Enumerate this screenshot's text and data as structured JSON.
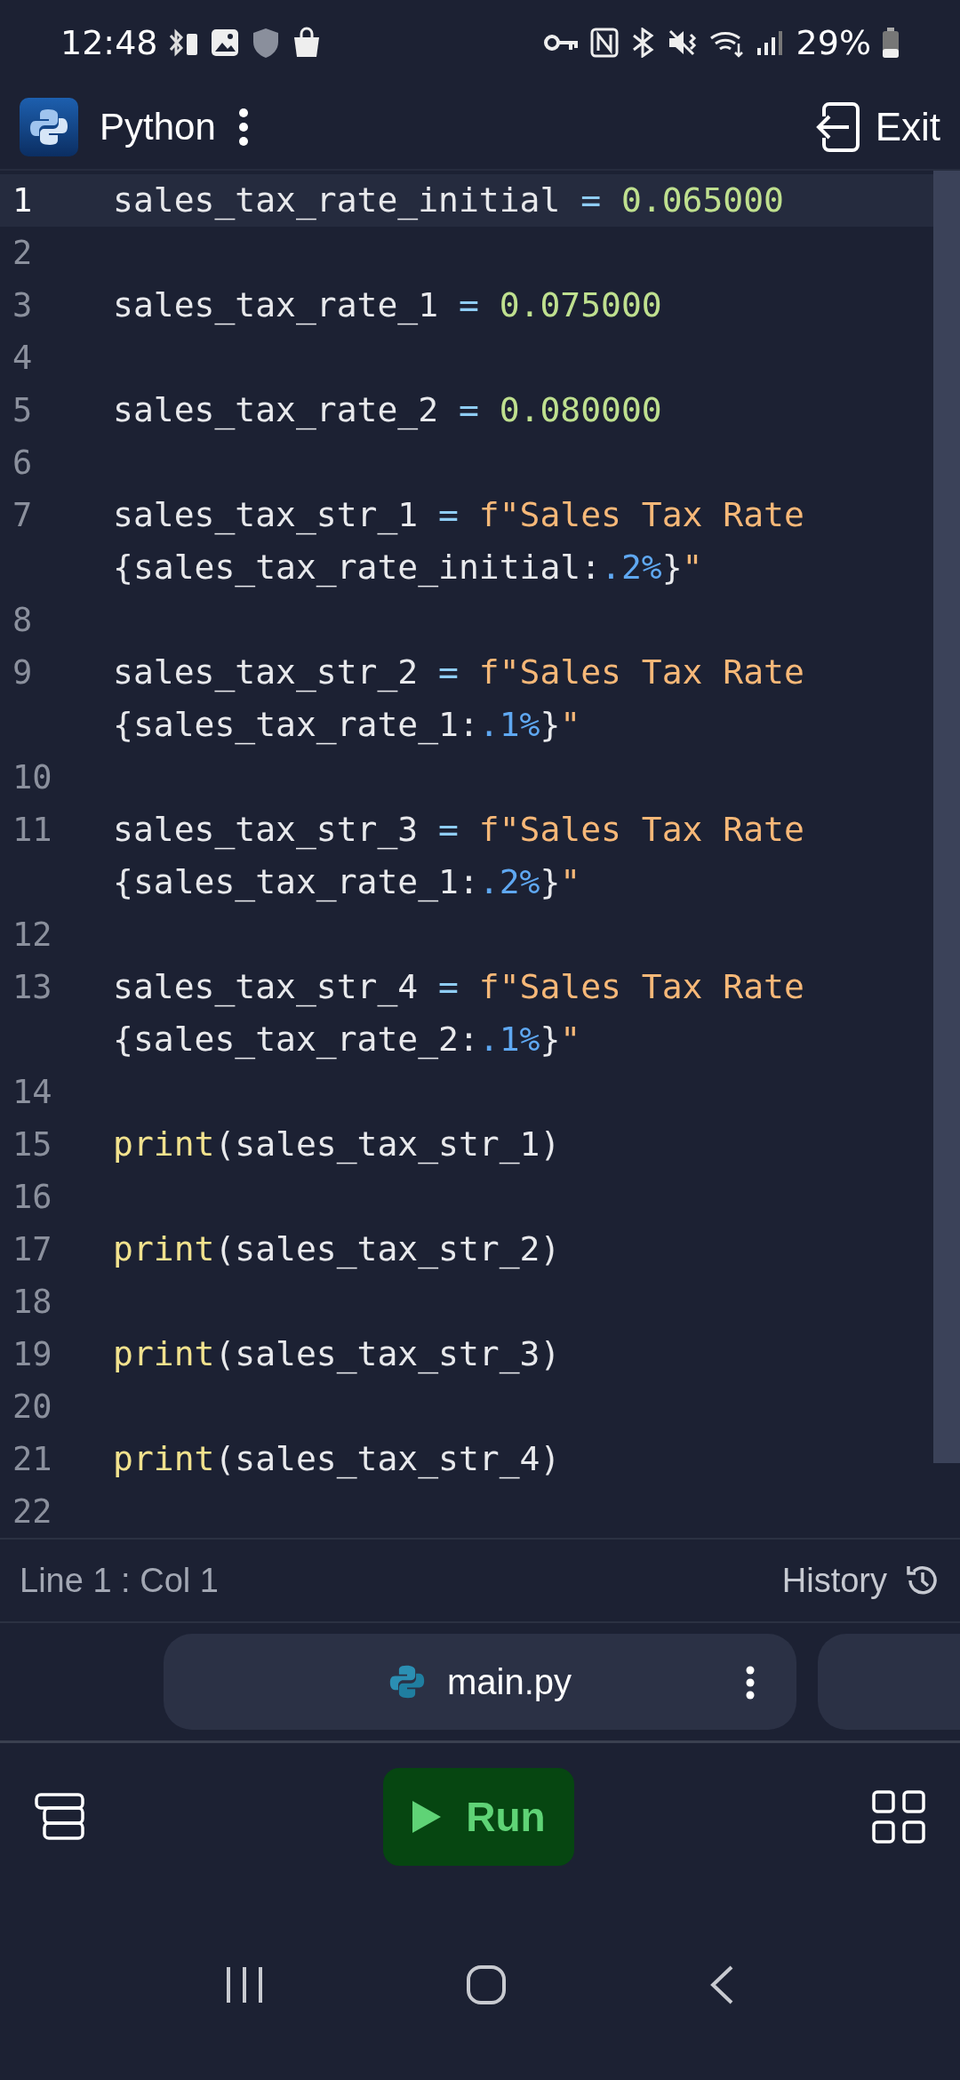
{
  "status_bar": {
    "time": "12:48",
    "battery": "29%"
  },
  "header": {
    "title": "Python",
    "exit": "Exit"
  },
  "editor": {
    "lines": [
      {
        "number": "1",
        "selected": true,
        "tokens": [
          {
            "kind": "plain",
            "text": "sales_tax_rate_initial "
          },
          {
            "kind": "op",
            "text": "="
          },
          {
            "kind": "num",
            "text": " 0.065000"
          }
        ]
      },
      {
        "number": "2",
        "selected": false
      },
      {
        "number": "3",
        "selected": false,
        "tokens": [
          {
            "kind": "plain",
            "text": "sales_tax_rate_1 "
          },
          {
            "kind": "op",
            "text": "="
          },
          {
            "kind": "num",
            "text": " 0.075000"
          }
        ]
      },
      {
        "number": "4",
        "selected": false
      },
      {
        "number": "5",
        "selected": false,
        "tokens": [
          {
            "kind": "plain",
            "text": "sales_tax_rate_2 "
          },
          {
            "kind": "op",
            "text": "="
          },
          {
            "kind": "num",
            "text": " 0.080000"
          }
        ]
      },
      {
        "number": "6",
        "selected": false
      },
      {
        "number": "7",
        "selected": false,
        "tokens": [
          {
            "kind": "plain",
            "text": "sales_tax_str_1 "
          },
          {
            "kind": "op",
            "text": "="
          },
          {
            "kind": "str",
            "text": " f\"Sales Tax Rate "
          },
          {
            "kind": "plain",
            "text": "{sales_tax_rate_initial:"
          },
          {
            "kind": "fmt",
            "text": ".2%"
          },
          {
            "kind": "plain",
            "text": "}"
          },
          {
            "kind": "str",
            "text": "\""
          }
        ]
      },
      {
        "number": "8",
        "selected": false
      },
      {
        "number": "9",
        "selected": false,
        "tokens": [
          {
            "kind": "plain",
            "text": "sales_tax_str_2 "
          },
          {
            "kind": "op",
            "text": "="
          },
          {
            "kind": "str",
            "text": " f\"Sales Tax Rate "
          },
          {
            "kind": "plain",
            "text": "{sales_tax_rate_1:"
          },
          {
            "kind": "fmt",
            "text": ".1%"
          },
          {
            "kind": "plain",
            "text": "}"
          },
          {
            "kind": "str",
            "text": "\""
          }
        ]
      },
      {
        "number": "10",
        "selected": false
      },
      {
        "number": "11",
        "selected": false,
        "tokens": [
          {
            "kind": "plain",
            "text": "sales_tax_str_3 "
          },
          {
            "kind": "op",
            "text": "="
          },
          {
            "kind": "str",
            "text": " f\"Sales Tax Rate "
          },
          {
            "kind": "plain",
            "text": "{sales_tax_rate_1:"
          },
          {
            "kind": "fmt",
            "text": ".2%"
          },
          {
            "kind": "plain",
            "text": "}"
          },
          {
            "kind": "str",
            "text": "\""
          }
        ]
      },
      {
        "number": "12",
        "selected": false
      },
      {
        "number": "13",
        "selected": false,
        "tokens": [
          {
            "kind": "plain",
            "text": "sales_tax_str_4 "
          },
          {
            "kind": "op",
            "text": "="
          },
          {
            "kind": "str",
            "text": " f\"Sales Tax Rate "
          },
          {
            "kind": "plain",
            "text": "{sales_tax_rate_2:"
          },
          {
            "kind": "fmt",
            "text": ".1%"
          },
          {
            "kind": "plain",
            "text": "}"
          },
          {
            "kind": "str",
            "text": "\""
          }
        ]
      },
      {
        "number": "14",
        "selected": false
      },
      {
        "number": "15",
        "selected": false,
        "tokens": [
          {
            "kind": "func",
            "text": "print"
          },
          {
            "kind": "plain",
            "text": "(sales_tax_str_1)"
          }
        ]
      },
      {
        "number": "16",
        "selected": false
      },
      {
        "number": "17",
        "selected": false,
        "tokens": [
          {
            "kind": "func",
            "text": "print"
          },
          {
            "kind": "plain",
            "text": "(sales_tax_str_2)"
          }
        ]
      },
      {
        "number": "18",
        "selected": false
      },
      {
        "number": "19",
        "selected": false,
        "tokens": [
          {
            "kind": "func",
            "text": "print"
          },
          {
            "kind": "plain",
            "text": "(sales_tax_str_3)"
          }
        ]
      },
      {
        "number": "20",
        "selected": false
      },
      {
        "number": "21",
        "selected": false,
        "tokens": [
          {
            "kind": "func",
            "text": "print"
          },
          {
            "kind": "plain",
            "text": "(sales_tax_str_4)"
          }
        ]
      },
      {
        "number": "22",
        "selected": false
      }
    ]
  },
  "cursor": {
    "position": "Line 1 : Col 1",
    "history": "History"
  },
  "file_tabs": [
    {
      "name": "main.py"
    }
  ],
  "toolbar": {
    "run": "Run"
  }
}
